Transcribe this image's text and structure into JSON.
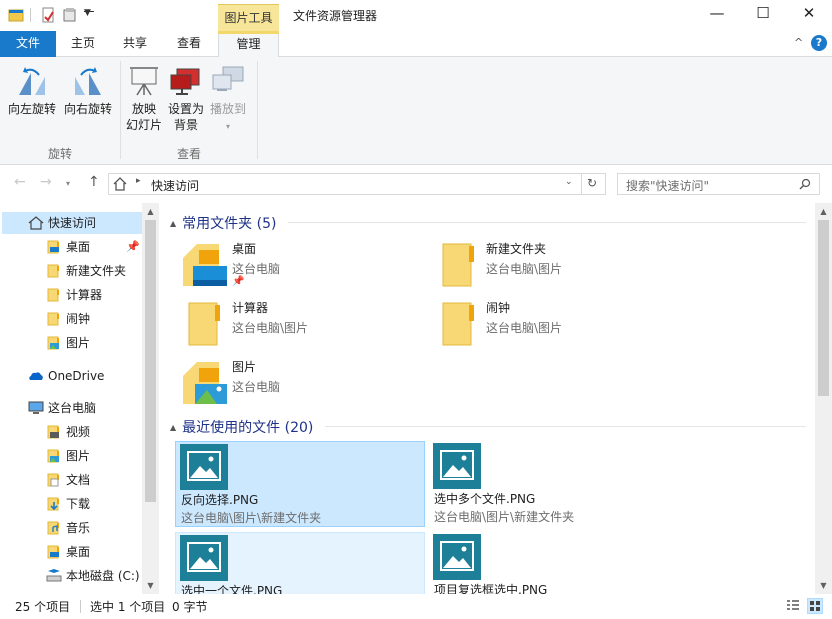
{
  "window": {
    "context_tab_header": "图片工具",
    "title": "文件资源管理器"
  },
  "tabs": {
    "file": "文件",
    "home": "主页",
    "share": "共享",
    "view": "查看",
    "manage": "管理"
  },
  "ribbon": {
    "rotate_left": "向左旋转",
    "rotate_right": "向右旋转",
    "slideshow_line1": "放映",
    "slideshow_line2": "幻灯片",
    "set_bg_line1": "设置为",
    "set_bg_line2": "背景",
    "cast": "播放到",
    "group_rotate": "旋转",
    "group_view": "查看"
  },
  "address": {
    "crumb": "快速访问",
    "search_placeholder": "搜索\"快速访问\""
  },
  "nav": {
    "quick_access": "快速访问",
    "qa_items": [
      "桌面",
      "新建文件夹",
      "计算器",
      "闹钟",
      "图片"
    ],
    "onedrive": "OneDrive",
    "this_pc": "这台电脑",
    "pc_items": [
      "视频",
      "图片",
      "文档",
      "下载",
      "音乐",
      "桌面",
      "本地磁盘 (C:)"
    ]
  },
  "content": {
    "frequent_header": "常用文件夹 (5)",
    "folders": [
      {
        "name": "桌面",
        "path": "这台电脑"
      },
      {
        "name": "新建文件夹",
        "path": "这台电脑\\图片"
      },
      {
        "name": "计算器",
        "path": "这台电脑\\图片"
      },
      {
        "name": "闹钟",
        "path": "这台电脑\\图片"
      },
      {
        "name": "图片",
        "path": "这台电脑"
      }
    ],
    "recent_header": "最近使用的文件 (20)",
    "files": [
      {
        "name": "反向选择.PNG",
        "path": "这台电脑\\图片\\新建文件夹"
      },
      {
        "name": "选中多个文件.PNG",
        "path": "这台电脑\\图片\\新建文件夹"
      },
      {
        "name": "选中一个文件.PNG",
        "path": ""
      },
      {
        "name": "项目复选框选中.PNG",
        "path": ""
      }
    ]
  },
  "status": {
    "count": "25 个项目",
    "selected": "选中 1 个项目",
    "size": "0 字节"
  },
  "colors": {
    "accent": "#1979ca",
    "selection": "#cce8ff",
    "context_tab": "#f7e59a",
    "section_header": "#1e3287",
    "thumb": "#1e7f98"
  }
}
